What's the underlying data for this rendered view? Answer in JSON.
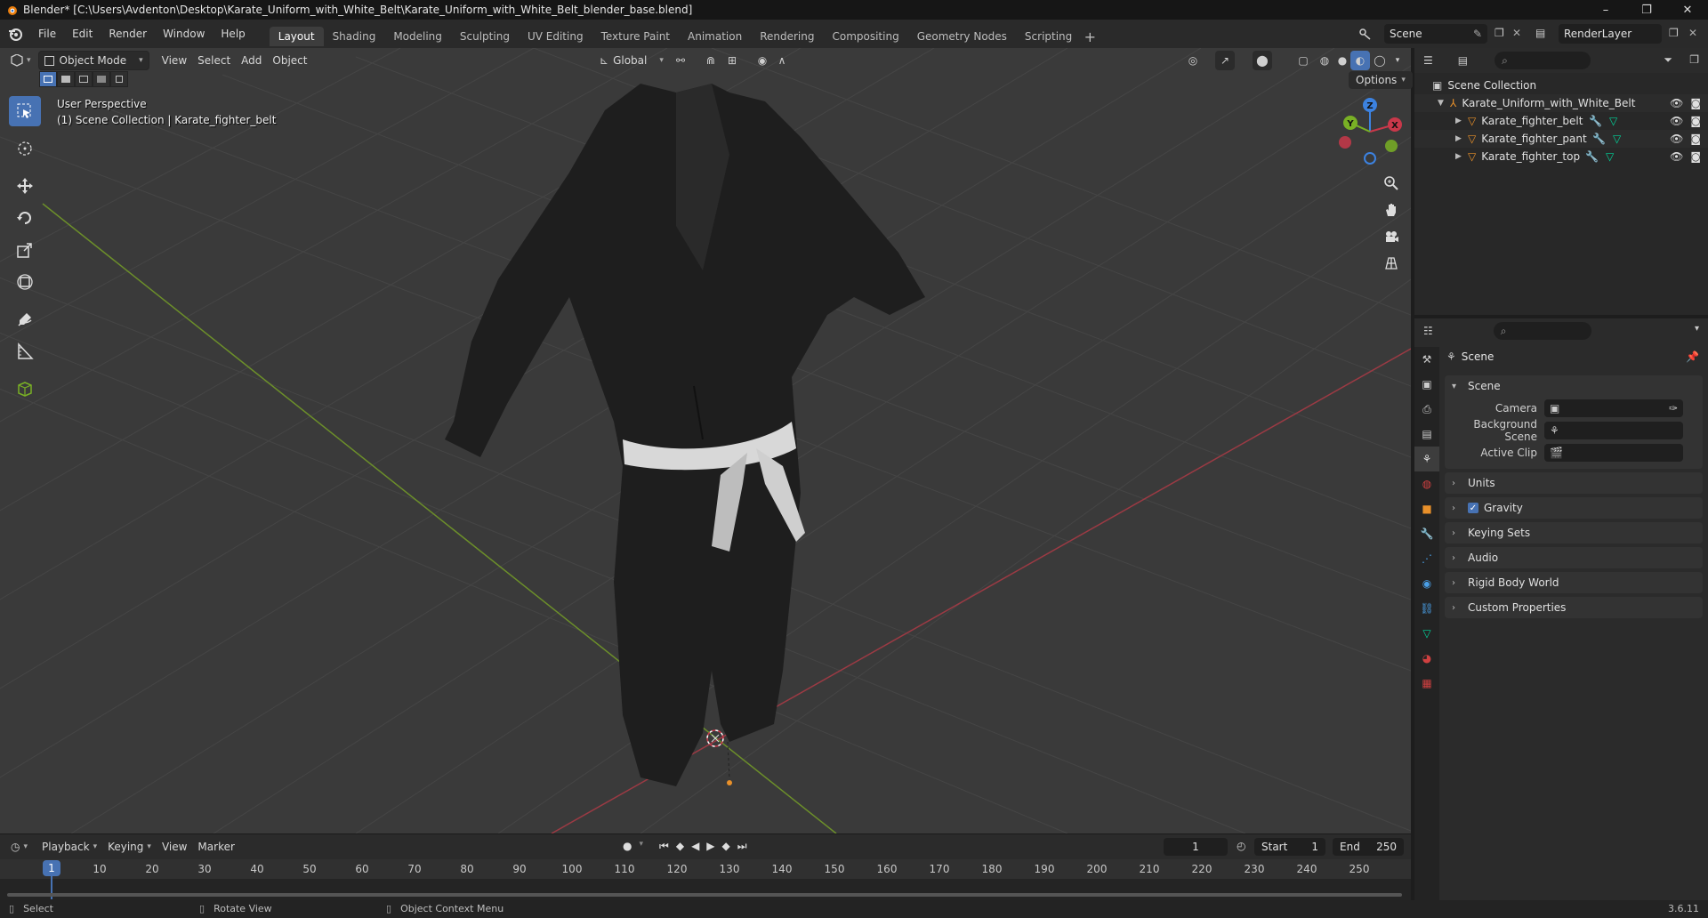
{
  "window": {
    "title": "Blender* [C:\\Users\\Avdenton\\Desktop\\Karate_Uniform_with_White_Belt\\Karate_Uniform_with_White_Belt_blender_base.blend]",
    "min": "–",
    "max": "❐",
    "close": "✕"
  },
  "menu": [
    "File",
    "Edit",
    "Render",
    "Window",
    "Help"
  ],
  "workspaces": [
    "Layout",
    "Shading",
    "Modeling",
    "Sculpting",
    "UV Editing",
    "Texture Paint",
    "Animation",
    "Rendering",
    "Compositing",
    "Geometry Nodes",
    "Scripting"
  ],
  "active_workspace": "Layout",
  "scene_name": "Scene",
  "render_layer": "RenderLayer",
  "viewport": {
    "mode": "Object Mode",
    "menus": [
      "View",
      "Select",
      "Add",
      "Object"
    ],
    "transform_orientation": "Global",
    "options_label": "Options",
    "info_line1": "User Perspective",
    "info_line2": "(1) Scene Collection | Karate_fighter_belt",
    "gizmo_axes": {
      "x": "X",
      "y": "Y",
      "z": "Z"
    }
  },
  "outliner": {
    "root": "Scene Collection",
    "collection": "Karate_Uniform_with_White_Belt",
    "objects": [
      "Karate_fighter_belt",
      "Karate_fighter_pant",
      "Karate_fighter_top"
    ]
  },
  "properties": {
    "context": "Scene",
    "scene_panel_title": "Scene",
    "camera_label": "Camera",
    "background_scene_label": "Background Scene",
    "active_clip_label": "Active Clip",
    "panels": [
      "Units",
      "Gravity",
      "Keying Sets",
      "Audio",
      "Rigid Body World",
      "Custom Properties"
    ],
    "gravity_checked": true
  },
  "timeline": {
    "menus": [
      "Playback",
      "Keying",
      "View",
      "Marker"
    ],
    "current_frame": "1",
    "start_label": "Start",
    "start_value": "1",
    "end_label": "End",
    "end_value": "250",
    "ticks": [
      "1",
      "10",
      "20",
      "30",
      "40",
      "50",
      "60",
      "70",
      "80",
      "90",
      "100",
      "110",
      "120",
      "130",
      "140",
      "150",
      "160",
      "170",
      "180",
      "190",
      "200",
      "210",
      "220",
      "230",
      "240",
      "250"
    ]
  },
  "status": {
    "select": "Select",
    "rotate": "Rotate View",
    "context_menu": "Object Context Menu",
    "version": "3.6.11"
  },
  "colors": {
    "accent": "#4772b3",
    "x_axis": "#c9384a",
    "y_axis": "#79b025",
    "z_axis": "#3c82e0",
    "object_orange": "#e8902a"
  }
}
